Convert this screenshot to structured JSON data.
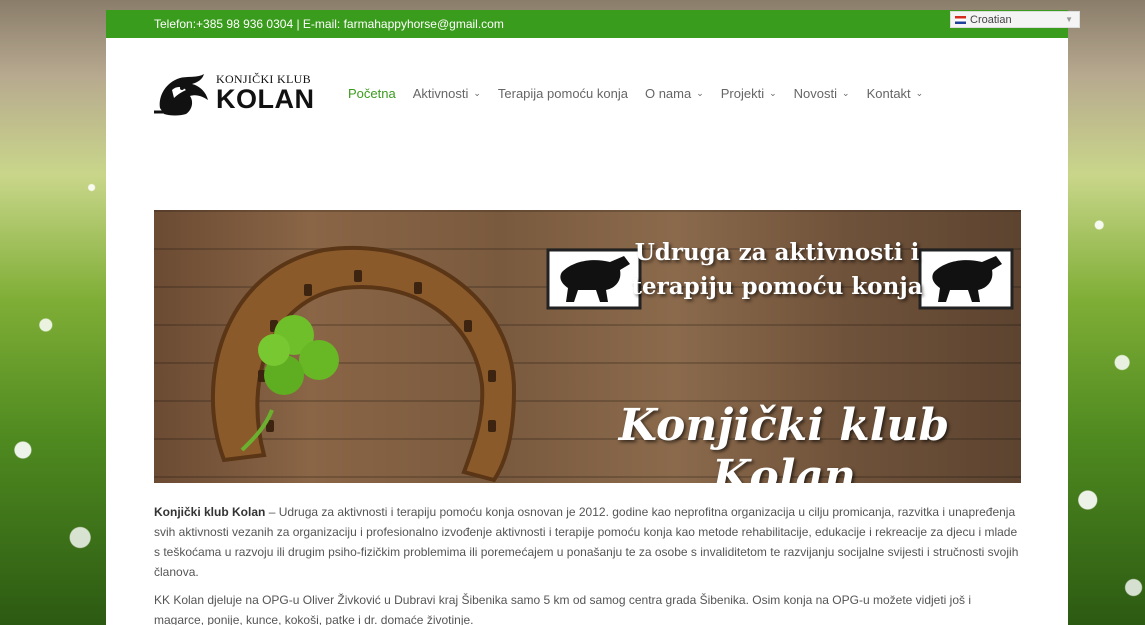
{
  "topbar": {
    "contact": "Telefon:+385 98 936 0304 | E-mail: farmahappyhorse@gmail.com",
    "language": "Croatian"
  },
  "logo": {
    "small_text": "KONJIČKI KLUB",
    "big_text": "KOLAN"
  },
  "nav": {
    "items": [
      {
        "label": "Početna",
        "active": true,
        "dropdown": false
      },
      {
        "label": "Aktivnosti",
        "dropdown": true
      },
      {
        "label": "Terapija pomoću konja",
        "dropdown": false
      },
      {
        "label": "O nama",
        "dropdown": true
      },
      {
        "label": "Projekti",
        "dropdown": true
      },
      {
        "label": "Novosti",
        "dropdown": true
      },
      {
        "label": "Kontakt",
        "dropdown": true
      }
    ]
  },
  "banner": {
    "tagline": "Udruga za aktivnosti i terapiju pomoću konja",
    "title": "Konjički klub Kolan"
  },
  "content": {
    "p1_strong": "Konjički klub Kolan",
    "p1_text": " – Udruga za aktivnosti i terapiju pomoću konja osnovan je 2012. godine kao neprofitna organizacija u cilju promicanja, razvitka i unapređenja svih aktivnosti vezanih za organizaciju i profesionalno izvođenje aktivnosti i terapije pomoću konja kao metode rehabilitacije, edukacije i rekreacije za djecu i mlade s teškoćama u razvoju ili drugim psiho-fizičkim problemima ili poremećajem u ponašanju te za osobe s invaliditetom te razvijanju socijalne svijesti i stručnosti svojih članova.",
    "p2": "KK Kolan djeluje na OPG-u Oliver Živković u Dubravi kraj Šibenika samo 5 km od samog centra grada Šibenika.  Osim konja na OPG-u možete vidjeti još i magarce, ponije, kunce, kokoši, patke i dr. domaće životinje."
  },
  "colors": {
    "accent": "#3a9c1c"
  }
}
